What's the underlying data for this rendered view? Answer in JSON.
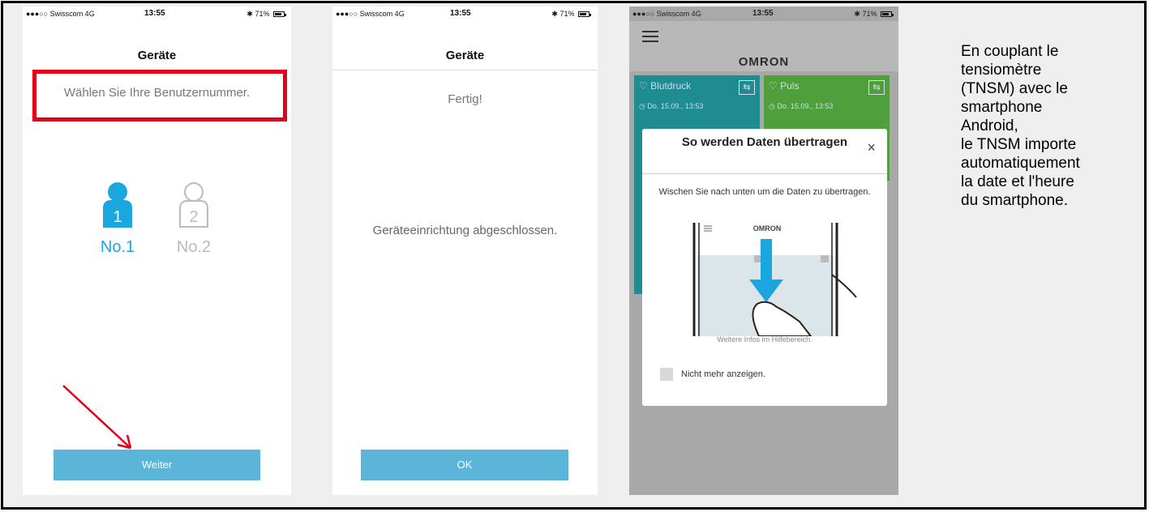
{
  "screens": [
    {
      "status": {
        "carrier": "●●●○○ Swisscom  4G",
        "time": "13:55",
        "battery": "✱ 71%"
      },
      "nav_title": "Geräte",
      "prompt": "Wählen Sie Ihre Benutzernummer.",
      "users": [
        {
          "number": "1",
          "label": "No.1"
        },
        {
          "number": "2",
          "label": "No.2"
        }
      ],
      "button": "Weiter"
    },
    {
      "status": {
        "carrier": "●●●○○ Swisscom  4G",
        "time": "13:55",
        "battery": "✱ 71%"
      },
      "nav_title": "Geräte",
      "heading": "Fertig!",
      "message": "Geräteeinrichtung abgeschlossen.",
      "button": "OK"
    },
    {
      "status": {
        "carrier": "●●●○○ Swisscom  4G",
        "time": "13:55",
        "battery": "✱ 71%"
      },
      "logo": "OMRON",
      "tiles": [
        {
          "title": "Blutdruck",
          "date": "Do. 15.09., 13:53"
        },
        {
          "title": "Puls",
          "date": "Do. 15.09., 13:53"
        }
      ],
      "modal": {
        "title": "So werden Daten übertragen",
        "close": "×",
        "text": "Wischen Sie nach unten um die Daten zu übertragen.",
        "illustration_logo": "OMRON",
        "info": "Weitere Infos im Hilfebereich.",
        "checkbox_label": "Nicht mehr anzeigen."
      }
    }
  ],
  "side_text": [
    "En couplant le",
    "tensiomètre",
    "(TNSM) avec le",
    "smartphone",
    "Android,",
    "le TNSM importe",
    "automatiquement",
    "la date et l'heure",
    "du smartphone."
  ],
  "colors": {
    "highlight_red": "#e0001a",
    "accent_blue": "#1aa7e0",
    "button_blue": "#5ab5d9",
    "tile_teal": "#1f8c92",
    "tile_green": "#4f9f3d"
  },
  "icons": [
    "user-icon",
    "bluetooth-icon",
    "battery-icon",
    "hamburger-icon",
    "heart-icon",
    "sync-icon",
    "clock-icon",
    "close-icon",
    "swipe-down-arrow-icon",
    "hand-icon"
  ]
}
